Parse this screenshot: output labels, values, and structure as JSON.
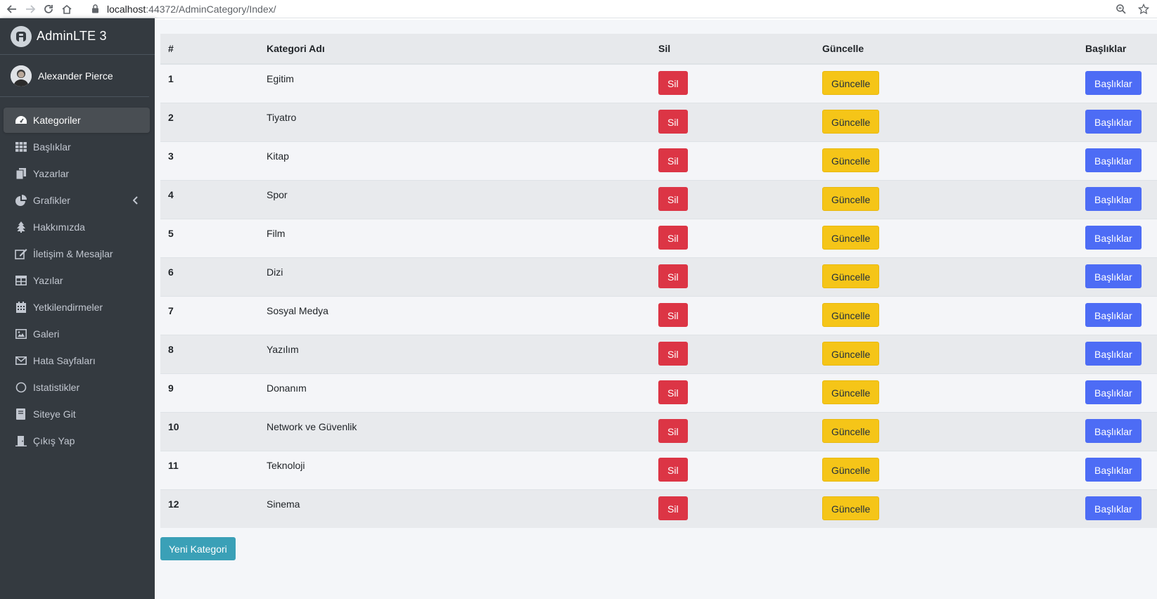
{
  "browser": {
    "url_host": "localhost",
    "url_path": ":44372/AdminCategory/Index/"
  },
  "sidebar": {
    "brand": "AdminLTE 3",
    "user": "Alexander Pierce",
    "items": [
      {
        "label": "Kategoriler",
        "icon": "dashboard-icon"
      },
      {
        "label": "Başlıklar",
        "icon": "grid-icon"
      },
      {
        "label": "Yazarlar",
        "icon": "copy-icon"
      },
      {
        "label": "Grafikler",
        "icon": "pie-chart-icon"
      },
      {
        "label": "Hakkımızda",
        "icon": "tree-icon"
      },
      {
        "label": "İletişim & Mesajlar",
        "icon": "edit-icon"
      },
      {
        "label": "Yazılar",
        "icon": "table-icon"
      },
      {
        "label": "Yetkilendirmeler",
        "icon": "calendar-icon"
      },
      {
        "label": "Galeri",
        "icon": "image-icon"
      },
      {
        "label": "Hata Sayfaları",
        "icon": "envelope-icon"
      },
      {
        "label": "Istatistikler",
        "icon": "circle-icon"
      },
      {
        "label": "Siteye Git",
        "icon": "book-icon"
      },
      {
        "label": "Çıkış Yap",
        "icon": "door-icon"
      }
    ]
  },
  "table": {
    "headers": [
      "#",
      "Kategori Adı",
      "Sil",
      "Güncelle",
      "Başlıklar"
    ],
    "rows": [
      {
        "id": "1",
        "name": "Egitim"
      },
      {
        "id": "2",
        "name": "Tiyatro"
      },
      {
        "id": "3",
        "name": "Kitap"
      },
      {
        "id": "4",
        "name": "Spor"
      },
      {
        "id": "5",
        "name": "Film"
      },
      {
        "id": "6",
        "name": "Dizi"
      },
      {
        "id": "7",
        "name": "Sosyal Medya"
      },
      {
        "id": "8",
        "name": "Yazılım"
      },
      {
        "id": "9",
        "name": "Donanım"
      },
      {
        "id": "10",
        "name": "Network ve Güvenlik"
      },
      {
        "id": "11",
        "name": "Teknoloji"
      },
      {
        "id": "12",
        "name": "Sinema"
      }
    ],
    "delete_label": "Sil",
    "update_label": "Güncelle",
    "titles_label": "Başlıklar"
  },
  "new_category_label": "Yeni Kategori",
  "colors": {
    "sidebar_bg": "#343a40",
    "danger": "#dc3545",
    "warning": "#f5c518",
    "primary": "#4d6cf5",
    "info": "#3aa0b7"
  }
}
